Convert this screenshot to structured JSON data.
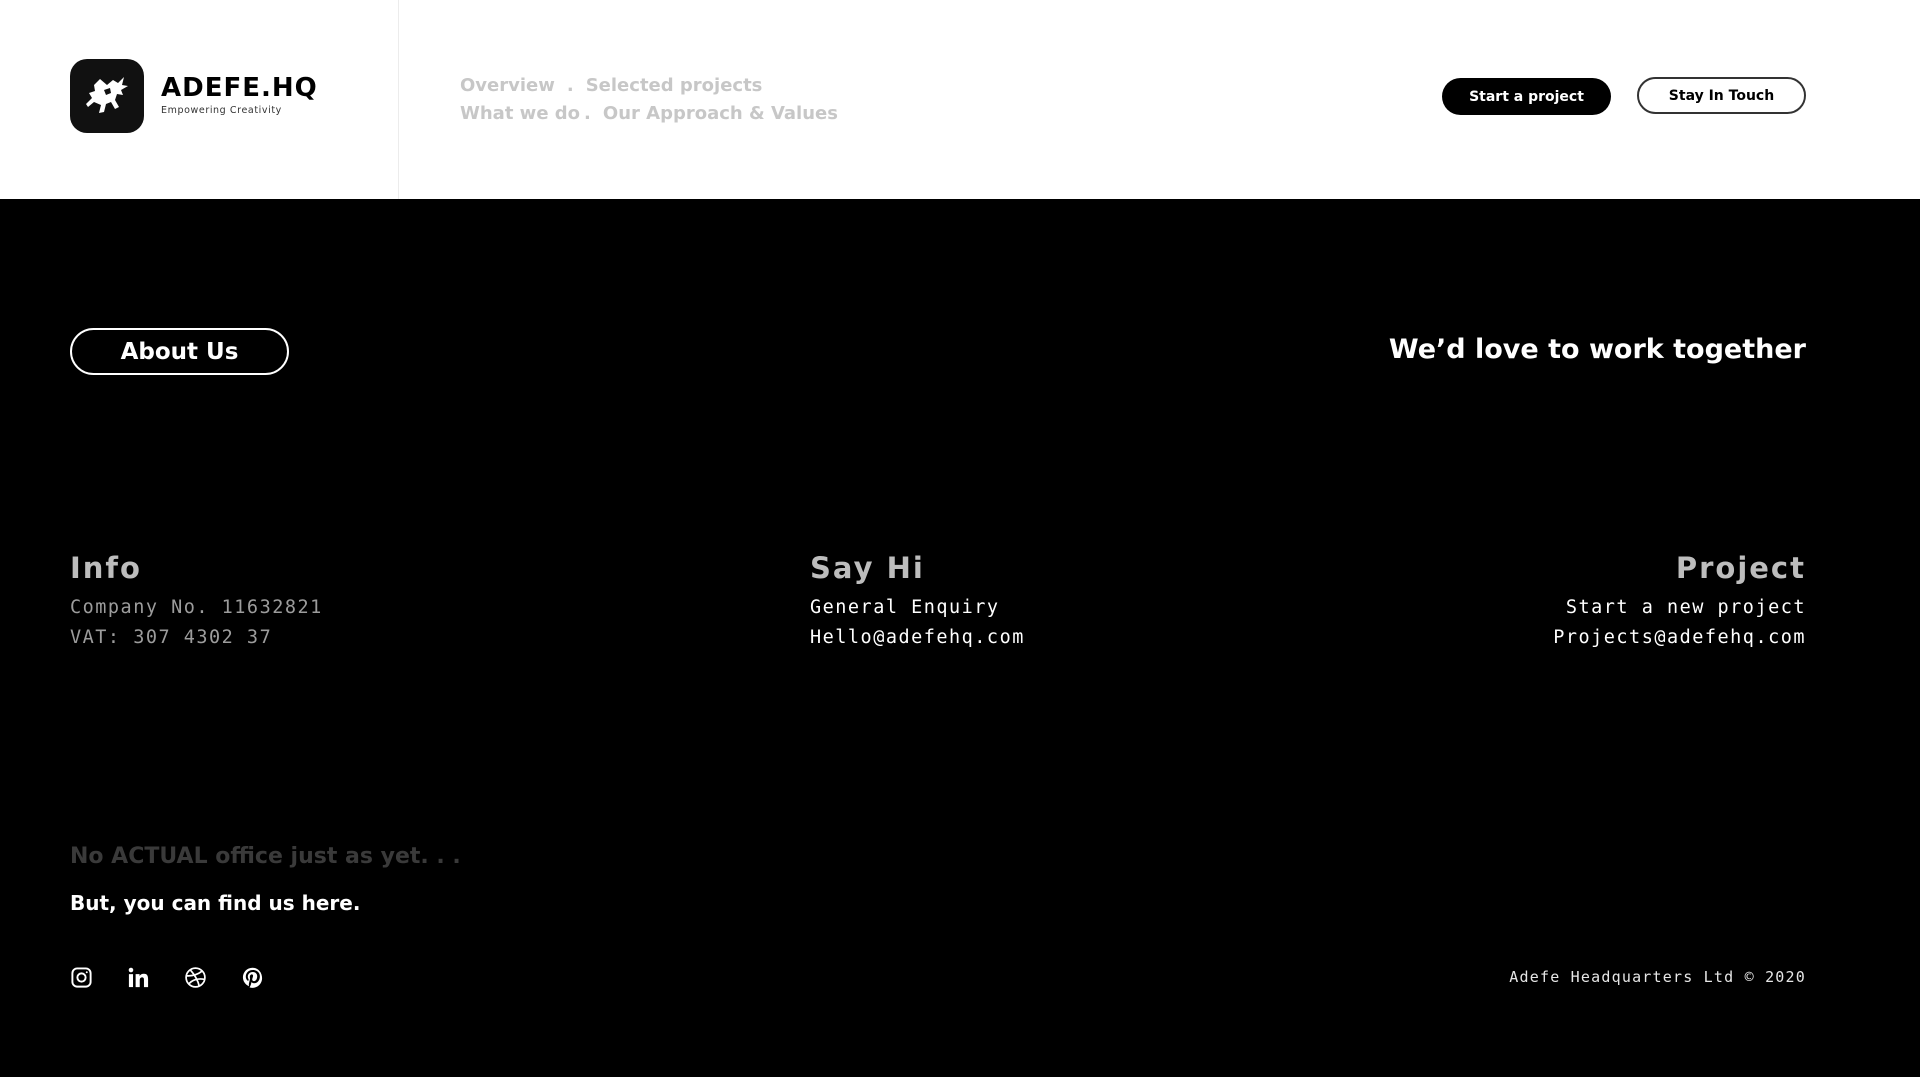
{
  "header": {
    "brand_name": "ADEFE.HQ",
    "brand_tagline": "Empowering Creativity",
    "nav": {
      "row1": [
        {
          "label": "Overview"
        },
        {
          "label": "Selected projects"
        }
      ],
      "row2": [
        {
          "label": "What we do"
        },
        {
          "label": "Our Approach & Values"
        }
      ]
    },
    "start_button": "Start a project",
    "touch_button": "Stay In Touch"
  },
  "main": {
    "about_label": "About Us",
    "tagline": "We’d love to work together",
    "info": {
      "title": "Info",
      "lines": [
        "Company No. 11632821",
        "VAT: 307 4302 37"
      ]
    },
    "say_hi": {
      "title": "Say Hi",
      "lines": [
        "General Enquiry",
        "Hello@adefehq.com"
      ]
    },
    "project": {
      "title": "Project",
      "lines": [
        "Start a new project",
        "Projects@adefehq.com"
      ]
    },
    "office_note": "No ACTUAL office just as yet. . .",
    "find_us": "But, you can find us here.",
    "socials": [
      {
        "icon": "instagram-icon"
      },
      {
        "icon": "linkedin-icon"
      },
      {
        "icon": "dribbble-icon"
      },
      {
        "icon": "pinterest-icon"
      }
    ],
    "copyright": "Adefe Headquarters Ltd © 2020"
  },
  "colors": {
    "background": "#000000",
    "header_bg": "#ffffff",
    "nav_text": "#c7c7c7",
    "muted_title": "#bdbdbd",
    "muted_text": "#9c9c9c",
    "dim_note": "#3a3a3a"
  }
}
